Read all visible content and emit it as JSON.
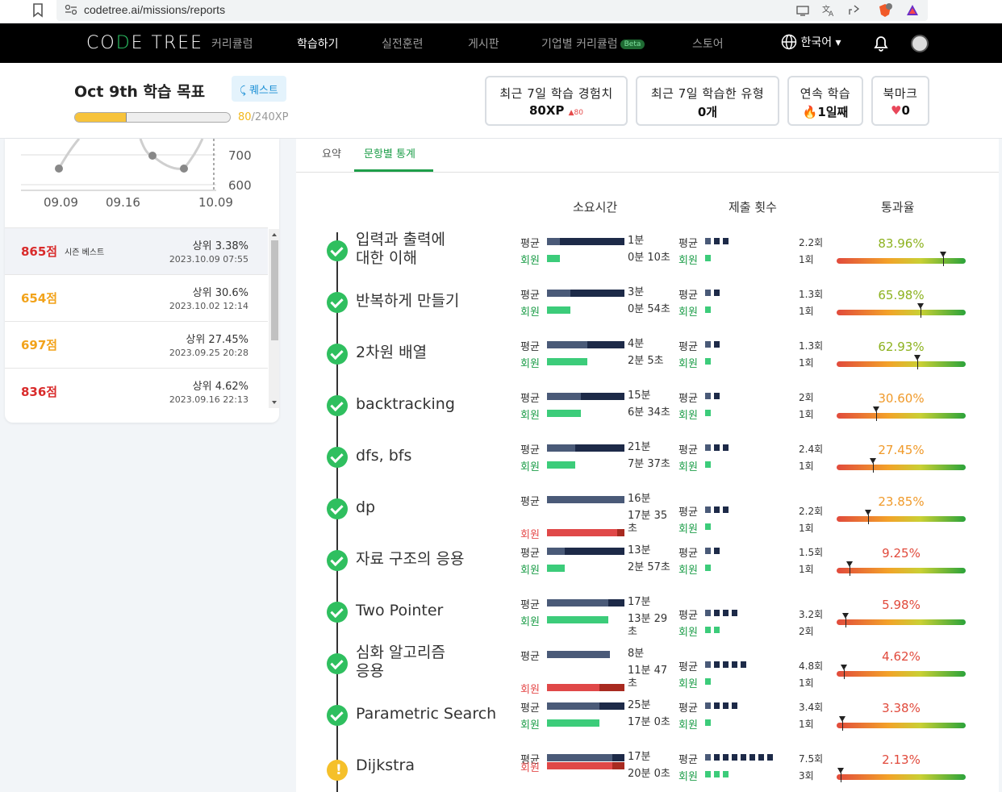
{
  "browser": {
    "url": "codetree.ai/missions/reports"
  },
  "nav": {
    "logo_left": "CO",
    "logo_mid": "D",
    "logo_right": "E TREE",
    "items": [
      "커리큘럼",
      "학습하기",
      "실전훈련",
      "게시판",
      "기업별 커리큘럼",
      "스토어"
    ],
    "beta": "Beta",
    "language": "한국어 ▾"
  },
  "header": {
    "goal_title": "Oct 9th 학습 목표",
    "quest_label": "퀘스트",
    "xp_current": "80",
    "xp_total": "/240XP",
    "xp_fraction": 0.333,
    "stats": [
      {
        "label": "최근 7일 학습 경험치",
        "value": "80XP",
        "delta": "▲80"
      },
      {
        "label": "최근 7일 학습한 유형",
        "value": "0개"
      },
      {
        "label": "연속 학습",
        "value": "🔥1일째"
      },
      {
        "label": "북마크",
        "value": "0"
      }
    ]
  },
  "chart_data": {
    "type": "line",
    "x_ticks": [
      "09.09",
      "09.16",
      "10.09"
    ],
    "y_ticks": [
      "700",
      "600"
    ]
  },
  "scores": [
    {
      "score": "865점",
      "badge": "시즌 베스트",
      "rank": "상위 3.38%",
      "date": "2023.10.09 07:55",
      "color": "#d92b2b"
    },
    {
      "score": "654점",
      "rank": "상위 30.6%",
      "date": "2023.10.02 12:14",
      "color": "#f2a31b"
    },
    {
      "score": "697점",
      "rank": "상위 27.45%",
      "date": "2023.09.25 20:28",
      "color": "#f2a31b"
    },
    {
      "score": "836점",
      "rank": "상위 4.62%",
      "date": "2023.09.16 22:13",
      "color": "#d92b2b"
    }
  ],
  "tabs": [
    "요약",
    "문항별 통계"
  ],
  "columns": [
    "소요시간",
    "제출 횟수",
    "통과율"
  ],
  "labels": {
    "avg": "평균",
    "member": "회원"
  },
  "topics": [
    {
      "name": "입력과 출력에\n대한 이해",
      "avg_time": "1분",
      "mem_time": "0분 10초",
      "avg_count": "2.2회",
      "mem_count": "1회",
      "pass_rate": "83.96%",
      "pass_value": 83.96,
      "status": "done"
    },
    {
      "name": "반복하게 만들기",
      "avg_time": "3분",
      "mem_time": "0분 54초",
      "avg_count": "1.3회",
      "mem_count": "1회",
      "pass_rate": "65.98%",
      "pass_value": 65.98,
      "status": "done"
    },
    {
      "name": "2차원 배열",
      "avg_time": "4분",
      "mem_time": "2분 5초",
      "avg_count": "1.3회",
      "mem_count": "1회",
      "pass_rate": "62.93%",
      "pass_value": 62.93,
      "status": "done"
    },
    {
      "name": "backtracking",
      "avg_time": "15분",
      "mem_time": "6분 34초",
      "avg_count": "2회",
      "mem_count": "1회",
      "pass_rate": "30.60%",
      "pass_value": 30.6,
      "status": "done"
    },
    {
      "name": "dfs, bfs",
      "avg_time": "21분",
      "mem_time": "7분 37초",
      "avg_count": "2.4회",
      "mem_count": "1회",
      "pass_rate": "27.45%",
      "pass_value": 27.45,
      "status": "done"
    },
    {
      "name": "dp",
      "avg_time": "16분",
      "mem_time": "17분 35\n초",
      "avg_count": "2.2회",
      "mem_count": "1회",
      "pass_rate": "23.85%",
      "pass_value": 23.85,
      "status": "done"
    },
    {
      "name": "자료 구조의 응용",
      "avg_time": "13분",
      "mem_time": "2분 57초",
      "avg_count": "1.5회",
      "mem_count": "1회",
      "pass_rate": "9.25%",
      "pass_value": 9.25,
      "status": "done"
    },
    {
      "name": "Two Pointer",
      "avg_time": "17분",
      "mem_time": "13분 29\n초",
      "avg_count": "3.2회",
      "mem_count": "2회",
      "pass_rate": "5.98%",
      "pass_value": 5.98,
      "status": "done"
    },
    {
      "name": "심화 알고리즘\n응용",
      "avg_time": "8분",
      "mem_time": "11분 47\n초",
      "avg_count": "4.8회",
      "mem_count": "1회",
      "pass_rate": "4.62%",
      "pass_value": 4.62,
      "status": "done"
    },
    {
      "name": "Parametric Search",
      "avg_time": "25분",
      "mem_time": "17분 0초",
      "avg_count": "3.4회",
      "mem_count": "1회",
      "pass_rate": "3.38%",
      "pass_value": 3.38,
      "status": "done"
    },
    {
      "name": "Dijkstra",
      "avg_time": "17분",
      "mem_time": "20분 0초",
      "avg_count": "7.5회",
      "mem_count": "3회",
      "pass_rate": "2.13%",
      "pass_value": 2.13,
      "status": "warn"
    }
  ]
}
